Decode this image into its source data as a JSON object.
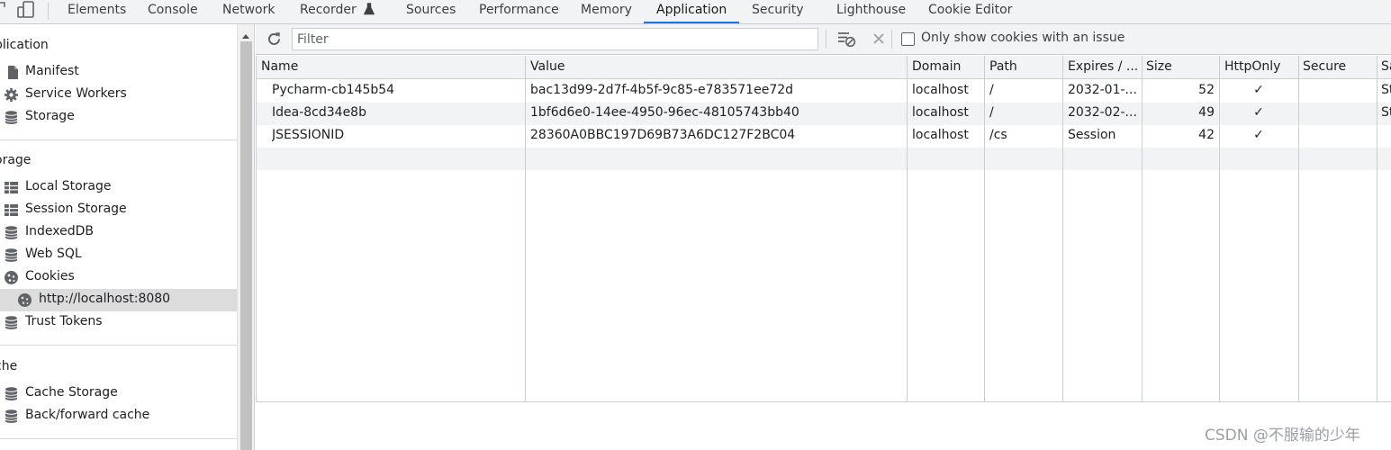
{
  "tabbar": {
    "tabs": [
      {
        "label": "Elements"
      },
      {
        "label": "Console"
      },
      {
        "label": "Network"
      },
      {
        "label": "Recorder"
      },
      {
        "label": "Sources"
      },
      {
        "label": "Performance"
      },
      {
        "label": "Memory"
      },
      {
        "label": "Application",
        "active": true
      },
      {
        "label": "Security"
      },
      {
        "label": "Lighthouse"
      },
      {
        "label": "Cookie Editor"
      }
    ],
    "icons": [
      "inspect-element-icon",
      "device-toolbar-icon",
      "flask-icon"
    ]
  },
  "sidebar": {
    "sections": {
      "application": {
        "title": "plication",
        "items": [
          {
            "label": "Manifest",
            "icon": "file-icon"
          },
          {
            "label": "Service Workers",
            "icon": "gear-icon"
          },
          {
            "label": "Storage",
            "icon": "database-icon"
          }
        ]
      },
      "storage": {
        "title": "orage",
        "items": [
          {
            "label": "Local Storage",
            "icon": "table-grid-icon"
          },
          {
            "label": "Session Storage",
            "icon": "table-grid-icon"
          },
          {
            "label": "IndexedDB",
            "icon": "database-icon"
          },
          {
            "label": "Web SQL",
            "icon": "database-icon"
          },
          {
            "label": "Cookies",
            "icon": "cookie-icon"
          },
          {
            "label": "http://localhost:8080",
            "icon": "cookie-icon",
            "selected": true
          },
          {
            "label": "Trust Tokens",
            "icon": "database-icon"
          }
        ]
      },
      "cache": {
        "title": "che",
        "items": [
          {
            "label": "Cache Storage",
            "icon": "database-icon"
          },
          {
            "label": "Back/forward cache",
            "icon": "database-icon"
          }
        ]
      }
    }
  },
  "toolbar": {
    "refresh_icon": "refresh-icon",
    "filter_placeholder": "Filter",
    "filter_value": "",
    "clear_filtered_icon": "clear-filtered-icon",
    "delete_icon": "close-icon",
    "only_issues_label": "Only show cookies with an issue",
    "only_issues_checked": false
  },
  "table": {
    "columns": [
      "Name",
      "Value",
      "Domain",
      "Path",
      "Expires / ...",
      "Size",
      "HttpOnly",
      "Secure",
      "Sa"
    ],
    "rows": [
      {
        "name": "Pycharm-cb145b54",
        "value": "bac13d99-2d7f-4b5f-9c85-e783571ee72d",
        "domain": "localhost",
        "path": "/",
        "expires": "2032-01-...",
        "size": "52",
        "httponly": "✓",
        "secure": "",
        "samesite": "St"
      },
      {
        "name": "Idea-8cd34e8b",
        "value": "1bf6d6e0-14ee-4950-96ec-48105743bb40",
        "domain": "localhost",
        "path": "/",
        "expires": "2032-02-...",
        "size": "49",
        "httponly": "✓",
        "secure": "",
        "samesite": "St"
      },
      {
        "name": "JSESSIONID",
        "value": "28360A0BBC197D69B73A6DC127F2BC04",
        "domain": "localhost",
        "path": "/cs",
        "expires": "Session",
        "size": "42",
        "httponly": "✓",
        "secure": "",
        "samesite": ""
      }
    ]
  },
  "colors": {
    "accent": "#1a73e8",
    "toolbar_bg": "#f1f3f4",
    "selected_bg": "#dcdcdc",
    "border": "#cacdd1"
  },
  "watermark": "CSDN @不服输的少年"
}
